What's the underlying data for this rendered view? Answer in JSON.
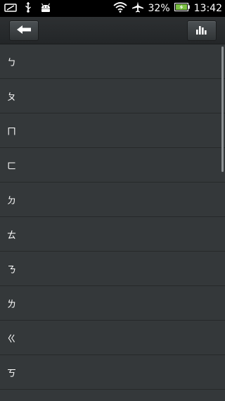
{
  "status_bar": {
    "battery": "32%",
    "time": "13:42"
  },
  "toolbar": {
    "back_icon": "arrow-left-icon",
    "chart_icon": "bar-chart-icon"
  },
  "list": {
    "items": [
      {
        "label": "ㄅ"
      },
      {
        "label": "ㄆ"
      },
      {
        "label": "ㄇ"
      },
      {
        "label": "ㄈ"
      },
      {
        "label": "ㄉ"
      },
      {
        "label": "ㄊ"
      },
      {
        "label": "ㄋ"
      },
      {
        "label": "ㄌ"
      },
      {
        "label": "ㄍ"
      },
      {
        "label": "ㄎ"
      }
    ]
  }
}
